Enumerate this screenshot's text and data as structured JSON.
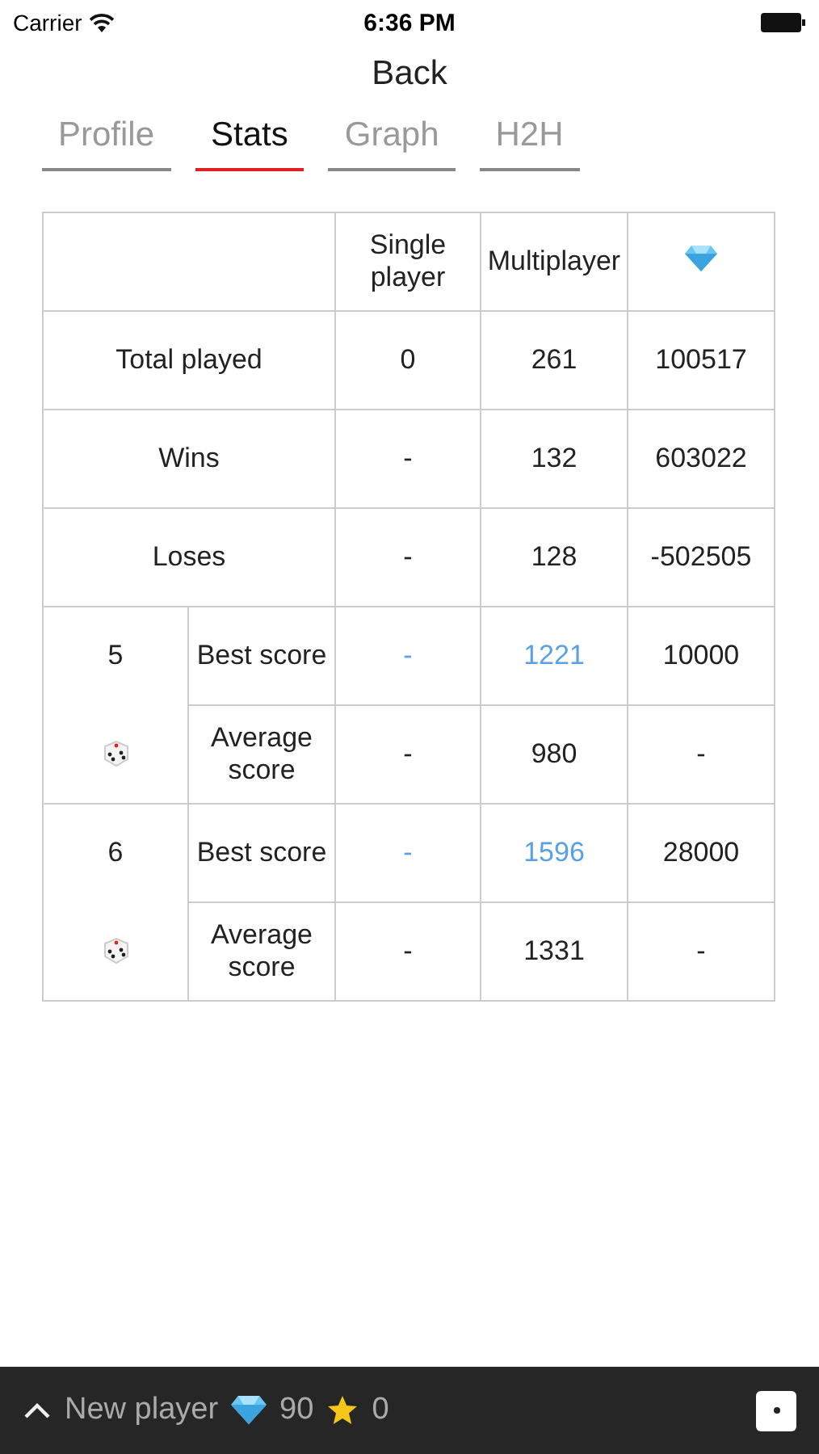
{
  "status_bar": {
    "carrier": "Carrier",
    "time": "6:36 PM"
  },
  "nav": {
    "back": "Back"
  },
  "tabs": [
    {
      "label": "Profile",
      "selected": false
    },
    {
      "label": "Stats",
      "selected": true
    },
    {
      "label": "Graph",
      "selected": false
    },
    {
      "label": "H2H",
      "selected": false
    }
  ],
  "table": {
    "columns": [
      "Single player",
      "Multiplayer"
    ],
    "rows": [
      {
        "label": "Total played",
        "values": [
          {
            "text": "0",
            "link": false
          },
          {
            "text": "261",
            "link": false
          },
          {
            "text": "100517",
            "link": false
          }
        ]
      },
      {
        "label": "Wins",
        "values": [
          {
            "text": "-",
            "link": false
          },
          {
            "text": "132",
            "link": false
          },
          {
            "text": "603022",
            "link": false
          }
        ]
      },
      {
        "label": "Loses",
        "values": [
          {
            "text": "-",
            "link": false
          },
          {
            "text": "128",
            "link": false
          },
          {
            "text": "-502505",
            "link": false
          }
        ]
      }
    ],
    "groups": [
      {
        "number": "5",
        "rows": [
          {
            "label": "Best score",
            "values": [
              {
                "text": "-",
                "link": true
              },
              {
                "text": "1221",
                "link": true
              },
              {
                "text": "10000",
                "link": false
              }
            ]
          },
          {
            "label": "Average score",
            "values": [
              {
                "text": "-",
                "link": false
              },
              {
                "text": "980",
                "link": false
              },
              {
                "text": "-",
                "link": false
              }
            ]
          }
        ]
      },
      {
        "number": "6",
        "rows": [
          {
            "label": "Best score",
            "values": [
              {
                "text": "-",
                "link": true
              },
              {
                "text": "1596",
                "link": true
              },
              {
                "text": "28000",
                "link": false
              }
            ]
          },
          {
            "label": "Average score",
            "values": [
              {
                "text": "-",
                "link": false
              },
              {
                "text": "1331",
                "link": false
              },
              {
                "text": "-",
                "link": false
              }
            ]
          }
        ]
      }
    ]
  },
  "bottom_bar": {
    "player": "New player",
    "gems": "90",
    "stars": "0"
  }
}
